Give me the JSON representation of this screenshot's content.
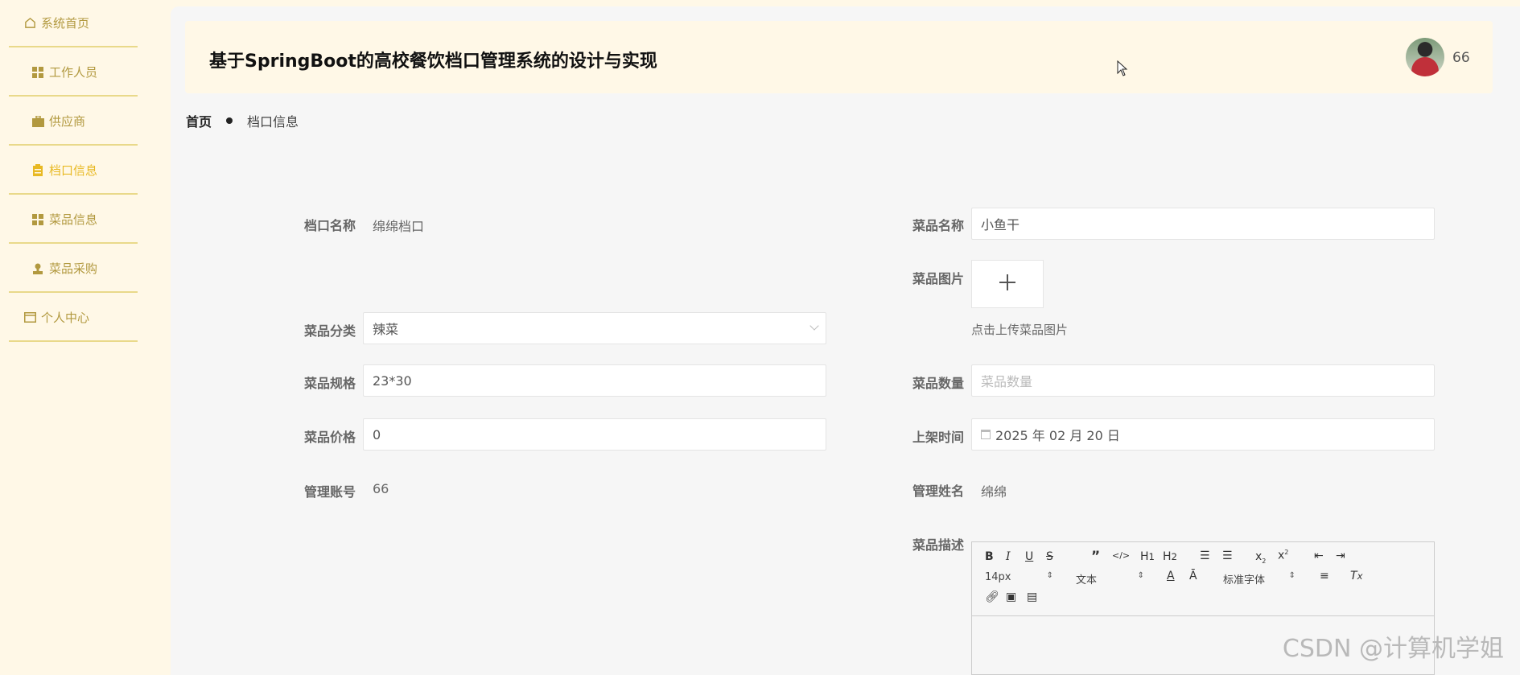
{
  "sidebar": {
    "items": [
      {
        "label": "系统首页",
        "icon": "home-icon"
      },
      {
        "label": "工作人员",
        "icon": "grid-icon"
      },
      {
        "label": "供应商",
        "icon": "briefcase-icon"
      },
      {
        "label": "档口信息",
        "icon": "clipboard-icon",
        "active": true
      },
      {
        "label": "菜品信息",
        "icon": "grid-icon"
      },
      {
        "label": "菜品采购",
        "icon": "stamp-icon"
      },
      {
        "label": "个人中心",
        "icon": "id-card-icon"
      }
    ]
  },
  "header": {
    "title": "基于SpringBoot的高校餐饮档口管理系统的设计与实现",
    "username": "66"
  },
  "breadcrumb": {
    "home": "首页",
    "current": "档口信息"
  },
  "form": {
    "stall_name_label": "档口名称",
    "stall_name_value": "绵绵档口",
    "dish_name_label": "菜品名称",
    "dish_name_value": "小鱼干",
    "dish_image_label": "菜品图片",
    "upload_plus": "+",
    "upload_hint": "点击上传菜品图片",
    "category_label": "菜品分类",
    "category_value": "辣菜",
    "spec_label": "菜品规格",
    "spec_value": "23*30",
    "quantity_label": "菜品数量",
    "quantity_placeholder": "菜品数量",
    "price_label": "菜品价格",
    "price_value": "0",
    "listing_time_label": "上架时间",
    "listing_time_value": "2025 年 02 月 20 日",
    "manager_account_label": "管理账号",
    "manager_account_value": "66",
    "manager_name_label": "管理姓名",
    "manager_name_value": "绵绵",
    "description_label": "菜品描述"
  },
  "editor": {
    "font_size": "14px",
    "text_type": "文本",
    "font_family": "标准字体",
    "buttons": [
      "bold",
      "italic",
      "underline",
      "strike",
      "blockquote",
      "code-block",
      "h1",
      "h2",
      "ordered-list",
      "bullet-list",
      "subscript",
      "superscript",
      "outdent",
      "indent",
      "font-color",
      "background-color",
      "align",
      "clear-format",
      "link",
      "image",
      "video"
    ]
  },
  "watermark": "CSDN @计算机学姐",
  "colors": {
    "sidebar_text": "#b2993f",
    "active": "#e8b923",
    "accent_line": "#e9d98a",
    "header_bg": "#fff8e7"
  }
}
